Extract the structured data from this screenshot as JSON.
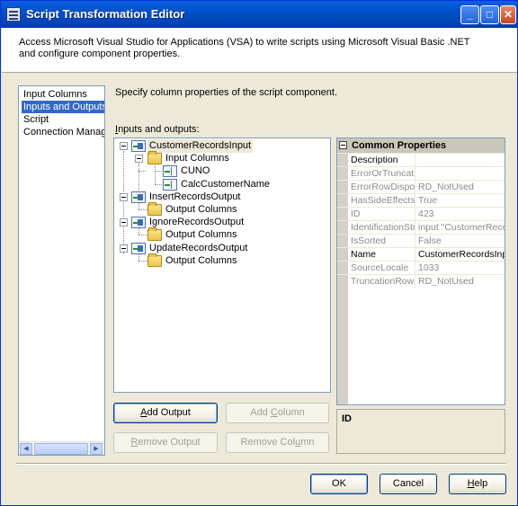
{
  "window": {
    "title": "Script Transformation Editor",
    "controls": {
      "minimize": "_",
      "maximize": "□",
      "close": "✕"
    }
  },
  "header": {
    "description": "Access Microsoft Visual Studio for Applications (VSA) to write scripts using Microsoft Visual Basic .NET and configure component properties."
  },
  "sidebar": {
    "items": [
      {
        "label": "Input Columns",
        "selected": false
      },
      {
        "label": "Inputs and Outputs",
        "selected": true
      },
      {
        "label": "Script",
        "selected": false
      },
      {
        "label": "Connection Managers",
        "selected": false
      }
    ]
  },
  "main": {
    "description": "Specify column properties of the script component.",
    "inputs_outputs_label_accel": "I",
    "inputs_outputs_label_rest": "nputs and outputs:"
  },
  "tree": {
    "nodes": [
      {
        "label": "CustomerRecordsInput",
        "icon": "input-icon"
      },
      {
        "label": "Input Columns",
        "icon": "folder-icon"
      },
      {
        "label": "CUNO",
        "icon": "column-icon"
      },
      {
        "label": "CalcCustomerName",
        "icon": "column-icon"
      },
      {
        "label": "InsertRecordsOutput",
        "icon": "output-icon"
      },
      {
        "label": "Output Columns",
        "icon": "folder-icon"
      },
      {
        "label": "IgnoreRecordsOutput",
        "icon": "output-icon"
      },
      {
        "label": "Output Columns",
        "icon": "folder-icon"
      },
      {
        "label": "UpdateRecordsOutput",
        "icon": "output-icon"
      },
      {
        "label": "Output Columns",
        "icon": "folder-icon"
      }
    ]
  },
  "buttons": {
    "add_output": {
      "accel": "A",
      "rest": "dd Output"
    },
    "add_column": {
      "pre": "Add ",
      "accel": "C",
      "rest": "olumn"
    },
    "remove_output": {
      "accel": "R",
      "rest": "emove Output"
    },
    "remove_column": {
      "pre": "Remove Col",
      "accel": "u",
      "rest": "mn"
    },
    "ok": "OK",
    "cancel": "Cancel",
    "help": {
      "accel": "H",
      "rest": "elp"
    }
  },
  "properties": {
    "category": "Common Properties",
    "rows": [
      {
        "name": "Description",
        "value": "",
        "readonly": false
      },
      {
        "name": "ErrorOrTruncatio",
        "value": "",
        "readonly": true
      },
      {
        "name": "ErrorRowDisposi",
        "value": "RD_NotUsed",
        "readonly": true
      },
      {
        "name": "HasSideEffects",
        "value": "True",
        "readonly": true
      },
      {
        "name": "ID",
        "value": "423",
        "readonly": true
      },
      {
        "name": "IdentificationStr",
        "value": "input \"CustomerRecord",
        "readonly": true
      },
      {
        "name": "IsSorted",
        "value": "False",
        "readonly": true
      },
      {
        "name": "Name",
        "value": "CustomerRecordsInput",
        "readonly": false
      },
      {
        "name": "SourceLocale",
        "value": "1033",
        "readonly": true
      },
      {
        "name": "TruncationRowD",
        "value": "RD_NotUsed",
        "readonly": true
      }
    ],
    "description_title": "ID"
  }
}
